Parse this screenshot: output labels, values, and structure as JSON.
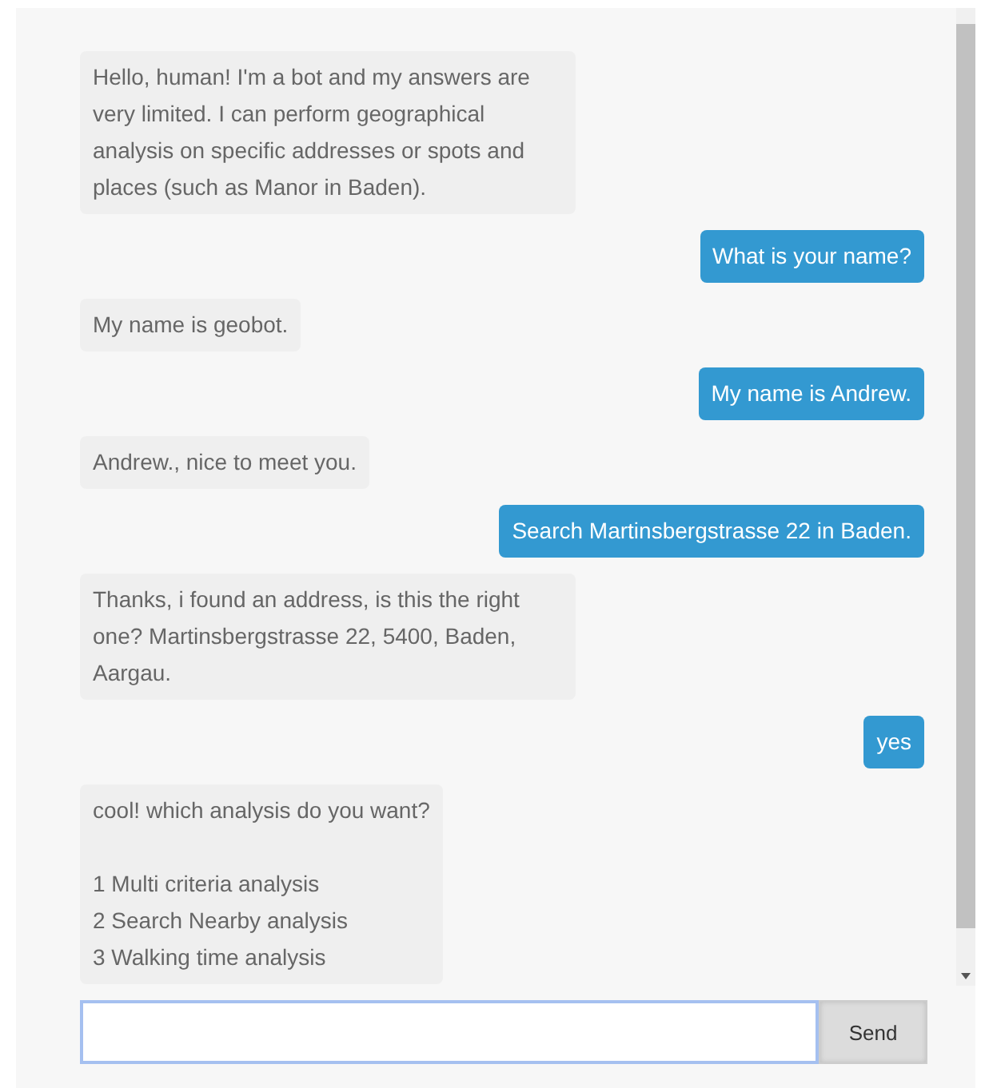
{
  "messages": [
    {
      "kind": "bot",
      "text": "Hello, human! I'm a bot and my answers are very limited. I can perform geographical analysis on specific addresses or spots and places (such as Manor in Baden)."
    },
    {
      "kind": "user",
      "text": "What is your name?"
    },
    {
      "kind": "bot",
      "text": "My name is geobot."
    },
    {
      "kind": "user",
      "text": "My name is Andrew."
    },
    {
      "kind": "bot",
      "text": "Andrew., nice to meet you."
    },
    {
      "kind": "user",
      "text": "Search Martinsbergstrasse 22 in Baden."
    },
    {
      "kind": "bot",
      "text": "Thanks, i found an address, is this the right one? Martinsbergstrasse 22, 5400, Baden, Aargau."
    },
    {
      "kind": "user",
      "text": "yes"
    },
    {
      "kind": "bot",
      "text": "cool! which analysis do you want?",
      "options": [
        "1 Multi criteria analysis",
        "2 Search Nearby analysis",
        "3 Walking time analysis"
      ]
    }
  ],
  "composer": {
    "send_label": "Send"
  }
}
